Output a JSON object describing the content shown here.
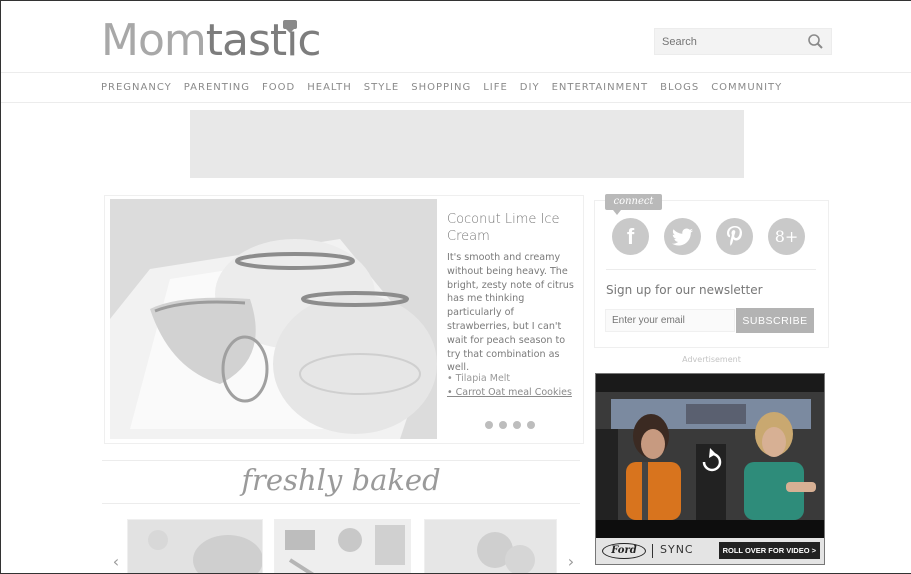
{
  "header": {
    "logo_part1": "Mom",
    "logo_part2": "tastic",
    "search_placeholder": "Search"
  },
  "nav": {
    "items": [
      "PREGNANCY",
      "PARENTING",
      "FOOD",
      "HEALTH",
      "STYLE",
      "SHOPPING",
      "LIFE",
      "DIY",
      "ENTERTAINMENT",
      "BLOGS",
      "COMMUNITY"
    ]
  },
  "featured": {
    "title": "Coconut Lime Ice Cream",
    "description": "It's smooth and creamy without being heavy. The bright, zesty note of citrus has me thinking particularly of strawberries, but I can't wait for peach season to try that combination as well.",
    "links": [
      "• Tilapia Melt",
      "• Carrot Oat meal Cookies"
    ],
    "slide_count": 4
  },
  "sidebar": {
    "connect_label": "connect",
    "social": [
      {
        "icon": "facebook-icon",
        "glyph": "f"
      },
      {
        "icon": "twitter-icon",
        "glyph": "t"
      },
      {
        "icon": "pinterest-icon",
        "glyph": "P"
      },
      {
        "icon": "google-plus-icon",
        "glyph": "g+"
      }
    ],
    "newsletter_title": "Sign up for our newsletter",
    "email_placeholder": "Enter your email",
    "subscribe_label": "SUBSCRIBE",
    "ad_label": "Advertisement"
  },
  "video_ad": {
    "brand": "Ford",
    "sync_text": "SYNC",
    "cta": "ROLL OVER FOR VIDEO >"
  },
  "freshly_baked": {
    "title": "freshly baked"
  },
  "colors": {
    "logo_light": "#a8a8a8",
    "logo_dark": "#7d7d7d",
    "social": "#c9c9c9",
    "subscribe": "#b3b3b3"
  }
}
